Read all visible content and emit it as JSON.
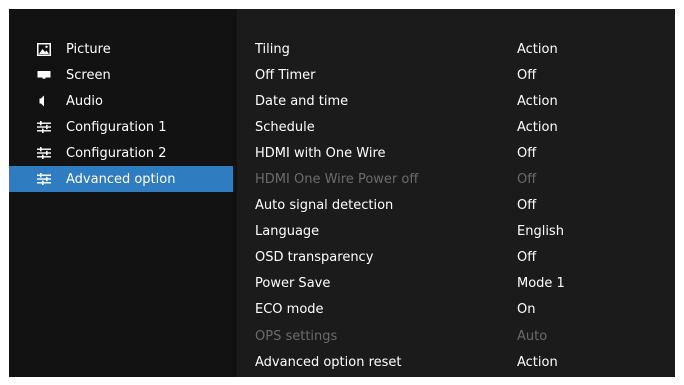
{
  "menu": {
    "items": [
      {
        "label": "Picture",
        "icon": "picture-icon"
      },
      {
        "label": "Screen",
        "icon": "screen-icon"
      },
      {
        "label": "Audio",
        "icon": "speaker-icon"
      },
      {
        "label": "Configuration 1",
        "icon": "sliders-icon"
      },
      {
        "label": "Configuration 2",
        "icon": "sliders-icon"
      },
      {
        "label": "Advanced option",
        "icon": "sliders-icon",
        "selected": true
      }
    ]
  },
  "settings": {
    "rows": [
      {
        "name": "Tiling",
        "value": "Action",
        "enabled": true
      },
      {
        "name": "Off Timer",
        "value": "Off",
        "enabled": true
      },
      {
        "name": "Date and time",
        "value": "Action",
        "enabled": true
      },
      {
        "name": "Schedule",
        "value": "Action",
        "enabled": true
      },
      {
        "name": "HDMI with One Wire",
        "value": "Off",
        "enabled": true
      },
      {
        "name": "HDMI One Wire Power off",
        "value": "Off",
        "enabled": false
      },
      {
        "name": "Auto signal detection",
        "value": "Off",
        "enabled": true
      },
      {
        "name": "Language",
        "value": "English",
        "enabled": true
      },
      {
        "name": "OSD transparency",
        "value": "Off",
        "enabled": true
      },
      {
        "name": "Power Save",
        "value": "Mode 1",
        "enabled": true
      },
      {
        "name": "ECO mode",
        "value": "On",
        "enabled": true
      },
      {
        "name": "OPS settings",
        "value": "Auto",
        "enabled": false
      },
      {
        "name": "Advanced option reset",
        "value": "Action",
        "enabled": true
      }
    ]
  },
  "colors": {
    "background": "#121212",
    "panel": "#1b1b1b",
    "selected": "#2f7cc0",
    "text": "#ffffff",
    "disabled_text": "#6b6b6b"
  }
}
